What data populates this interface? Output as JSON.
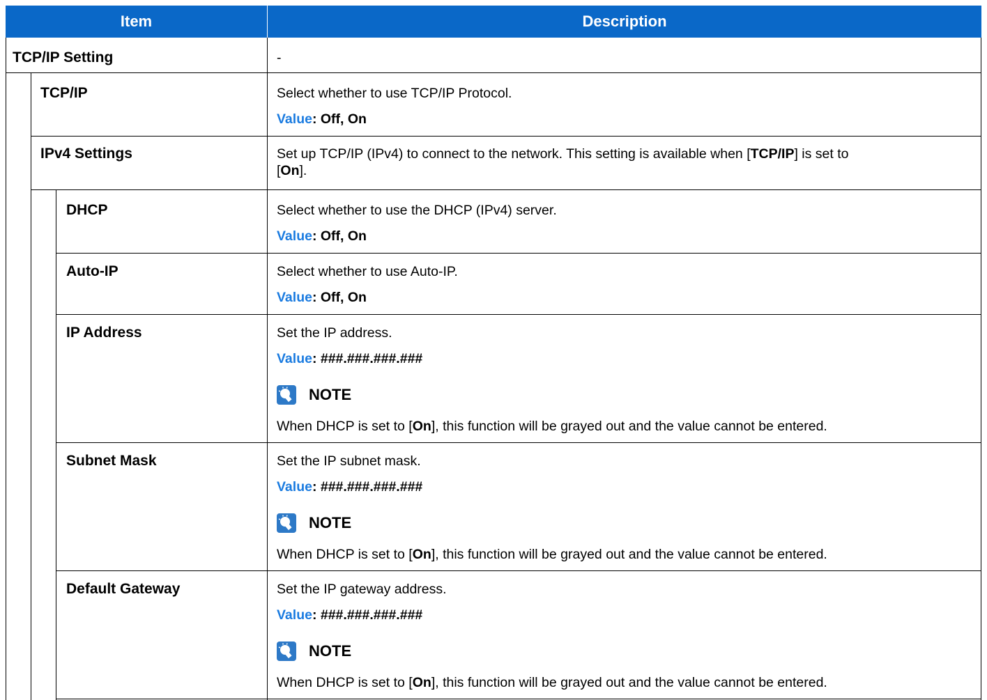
{
  "header": {
    "item": "Item",
    "description": "Description"
  },
  "rows": {
    "tcpip_setting": {
      "label": "TCP/IP Setting",
      "desc": "-"
    },
    "tcpip": {
      "label": "TCP/IP",
      "desc": "Select whether to use TCP/IP Protocol.",
      "value_label": "Value",
      "value": ": Off, On"
    },
    "ipv4": {
      "label": "IPv4 Settings",
      "desc_1": "Set up TCP/IP (IPv4) to connect to the network. This setting is available when [",
      "desc_b1": "TCP/IP",
      "desc_2": "] is set to",
      "desc_3": "[",
      "desc_b2": "On",
      "desc_4": "]."
    },
    "dhcp": {
      "label": "DHCP",
      "desc": "Select whether to use the DHCP (IPv4) server.",
      "value_label": "Value",
      "value": ": Off, On"
    },
    "autoip": {
      "label": "Auto-IP",
      "desc": "Select whether to use Auto-IP.",
      "value_label": "Value",
      "value": ": Off, On"
    },
    "ipaddr": {
      "label": "IP Address",
      "desc": "Set the IP address.",
      "value_label": "Value",
      "value": ": ###.###.###.###"
    },
    "subnet": {
      "label": "Subnet Mask",
      "desc": "Set the IP subnet mask.",
      "value_label": "Value",
      "value": ": ###.###.###.###"
    },
    "gateway": {
      "label": "Default Gateway",
      "desc": "Set the IP gateway address.",
      "value_label": "Value",
      "value": ": ###.###.###.###"
    }
  },
  "note": {
    "title": "NOTE",
    "text_1": "When DHCP is set to [",
    "text_bold": "On",
    "text_2": "], this function will be grayed out and the value cannot be entered."
  },
  "colors": {
    "header_bg": "#0a68c8",
    "value_label": "#1a7be0",
    "icon_bg": "#2d79c7"
  },
  "icons": {
    "note": "lightbulb-icon"
  }
}
